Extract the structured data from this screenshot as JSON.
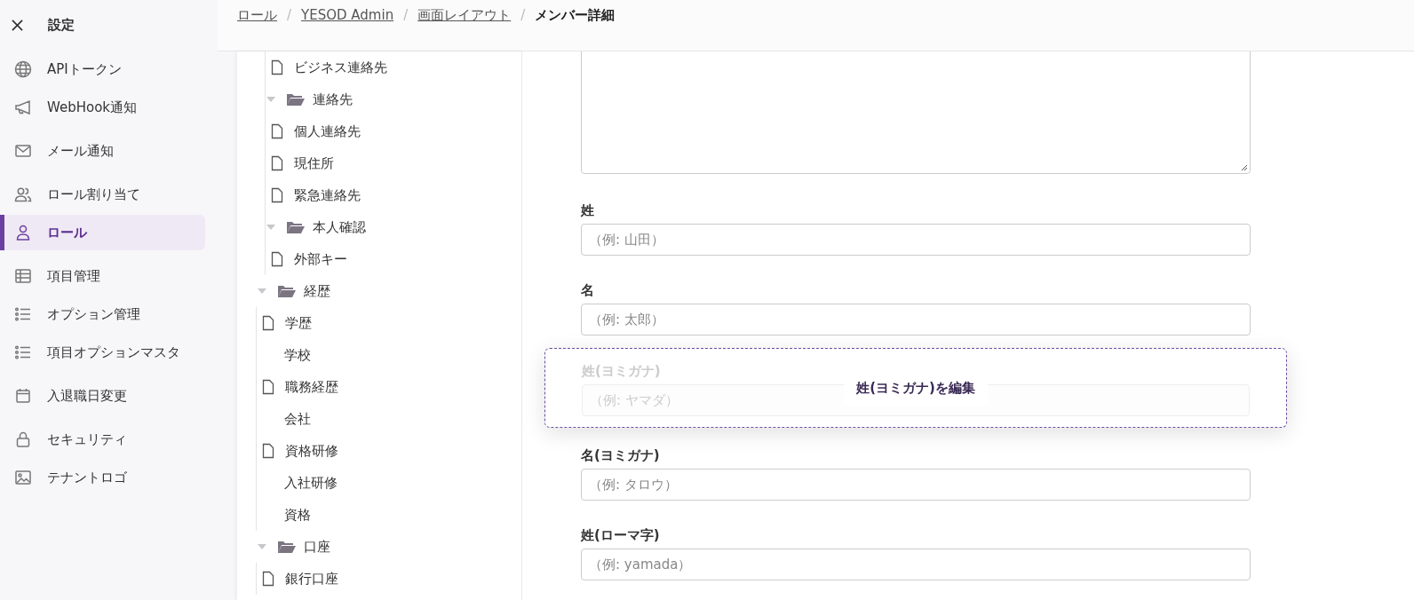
{
  "sidebar": {
    "title": "設定",
    "groups": [
      [
        {
          "label": "APIトークン",
          "selected": false
        },
        {
          "label": "WebHook通知",
          "selected": false
        }
      ],
      [
        {
          "label": "メール通知",
          "selected": false
        }
      ],
      [
        {
          "label": "ロール割り当て",
          "selected": false
        },
        {
          "label": "ロール",
          "selected": true
        }
      ],
      [
        {
          "label": "項目管理",
          "selected": false
        },
        {
          "label": "オプション管理",
          "selected": false
        },
        {
          "label": "項目オプションマスタ",
          "selected": false
        }
      ],
      [
        {
          "label": "入退職日変更",
          "selected": false
        }
      ],
      [
        {
          "label": "セキュリティ",
          "selected": false
        },
        {
          "label": "テナントロゴ",
          "selected": false
        }
      ]
    ]
  },
  "breadcrumb": {
    "links": [
      "ロール",
      "YESOD Admin",
      "画面レイアウト"
    ],
    "separators": [
      "/",
      "/",
      "/"
    ],
    "current": "メンバー詳細"
  },
  "tree": {
    "continued_items": [
      {
        "label": "ビジネス連絡先",
        "kind": "file"
      },
      {
        "label": "連絡先",
        "kind": "folder",
        "expanded": true,
        "children": [
          {
            "label": "個人連絡先",
            "kind": "file"
          },
          {
            "label": "現住所",
            "kind": "file"
          },
          {
            "label": "緊急連絡先",
            "kind": "file"
          }
        ]
      },
      {
        "label": "本人確認",
        "kind": "folder",
        "expanded": true,
        "children": [
          {
            "label": "外部キー",
            "kind": "file"
          }
        ]
      }
    ],
    "items": [
      {
        "label": "経歴",
        "kind": "folder",
        "expanded": true,
        "children": [
          {
            "label": "学歴",
            "kind": "file",
            "children": [
              {
                "label": "学校",
                "kind": "field"
              }
            ]
          },
          {
            "label": "職務経歴",
            "kind": "file",
            "children": [
              {
                "label": "会社",
                "kind": "field"
              }
            ]
          },
          {
            "label": "資格研修",
            "kind": "file",
            "children": [
              {
                "label": "入社研修",
                "kind": "field"
              },
              {
                "label": "資格",
                "kind": "field"
              }
            ]
          }
        ]
      },
      {
        "label": "口座",
        "kind": "folder",
        "expanded": true,
        "children": [
          {
            "label": "銀行口座",
            "kind": "file"
          }
        ]
      }
    ]
  },
  "form": {
    "fields": [
      {
        "kind": "textarea"
      },
      {
        "kind": "text",
        "label": "姓",
        "placeholder": "（例: 山田）",
        "dragging": false
      },
      {
        "kind": "text",
        "label": "名",
        "placeholder": "（例: 太郎）",
        "dragging": false
      },
      {
        "kind": "text",
        "label": "姓(ヨミガナ)",
        "placeholder": "（例: ヤマダ）",
        "dragging": true,
        "drag_label": "姓(ヨミガナ)を編集"
      },
      {
        "kind": "text",
        "label": "名(ヨミガナ)",
        "placeholder": "（例: タロウ）",
        "dragging": false
      },
      {
        "kind": "text",
        "label": "姓(ローマ字)",
        "placeholder": "（例: yamada）",
        "dragging": false
      }
    ]
  }
}
